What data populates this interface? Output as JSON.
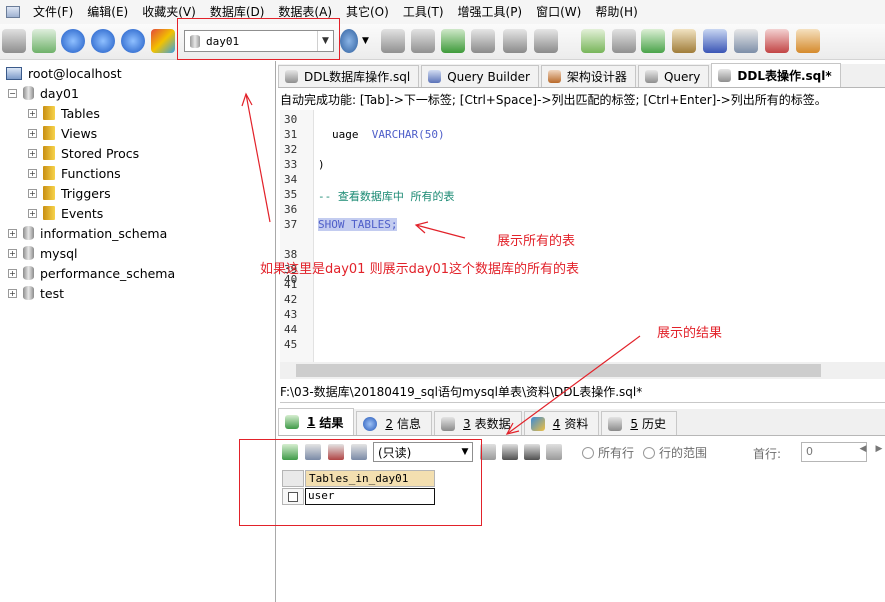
{
  "menu": [
    "文件(F)",
    "编辑(E)",
    "收藏夹(V)",
    "数据库(D)",
    "数据表(A)",
    "其它(O)",
    "工具(T)",
    "增强工具(P)",
    "窗口(W)",
    "帮助(H)"
  ],
  "toolbar": {
    "database_select": "day01"
  },
  "tree": {
    "root": "root@localhost",
    "db_open": "day01",
    "children": [
      "Tables",
      "Views",
      "Stored Procs",
      "Functions",
      "Triggers",
      "Events"
    ],
    "other_dbs": [
      "information_schema",
      "mysql",
      "performance_schema",
      "test"
    ]
  },
  "tabs": [
    "DDL数据库操作.sql",
    "Query Builder",
    "架构设计器",
    "Query",
    "DDL表操作.sql*"
  ],
  "hint": "自动完成功能: [Tab]->下一标签; [Ctrl+Space]->列出匹配的标签; [Ctrl+Enter]->列出所有的标签。",
  "editor": {
    "line_numbers": [
      "30",
      "31",
      "32",
      "33",
      "34",
      "35",
      "36",
      "37",
      "38",
      "39",
      "40",
      "41",
      "42",
      "43",
      "44",
      "45"
    ],
    "line31_col": "uage",
    "line31_type": "VARCHAR",
    "line31_rest": "(50)",
    "line33": ")",
    "line35_comment": "-- 查看数据库中 所有的表",
    "line37_sql": "SHOW TABLES;"
  },
  "file_path": "F:\\03-数据库\\20180419_sql语句mysql单表\\资料\\DDL表操作.sql*",
  "result_tabs": [
    {
      "num": "1",
      "label": "结果"
    },
    {
      "num": "2",
      "label": "信息"
    },
    {
      "num": "3",
      "label": "表数据"
    },
    {
      "num": "4",
      "label": "资料"
    },
    {
      "num": "5",
      "label": "历史"
    }
  ],
  "result_toolbar": {
    "mode": "(只读)",
    "radio_all": "所有行",
    "radio_range": "行的范围",
    "first_row_label": "首行:",
    "first_row_value": "0"
  },
  "result_grid": {
    "header": "Tables_in_day01",
    "rows": [
      "user"
    ]
  },
  "annotations": {
    "show_all": "展示所有的表",
    "explain": "如果这里是day01 则展示day01这个数据库的所有的表",
    "result": "展示的结果"
  },
  "colors": {
    "annotation": "#e2222a",
    "keyword": "#4f5fc9",
    "comment": "#1a8a73",
    "header_bg": "#f3dfb0"
  }
}
